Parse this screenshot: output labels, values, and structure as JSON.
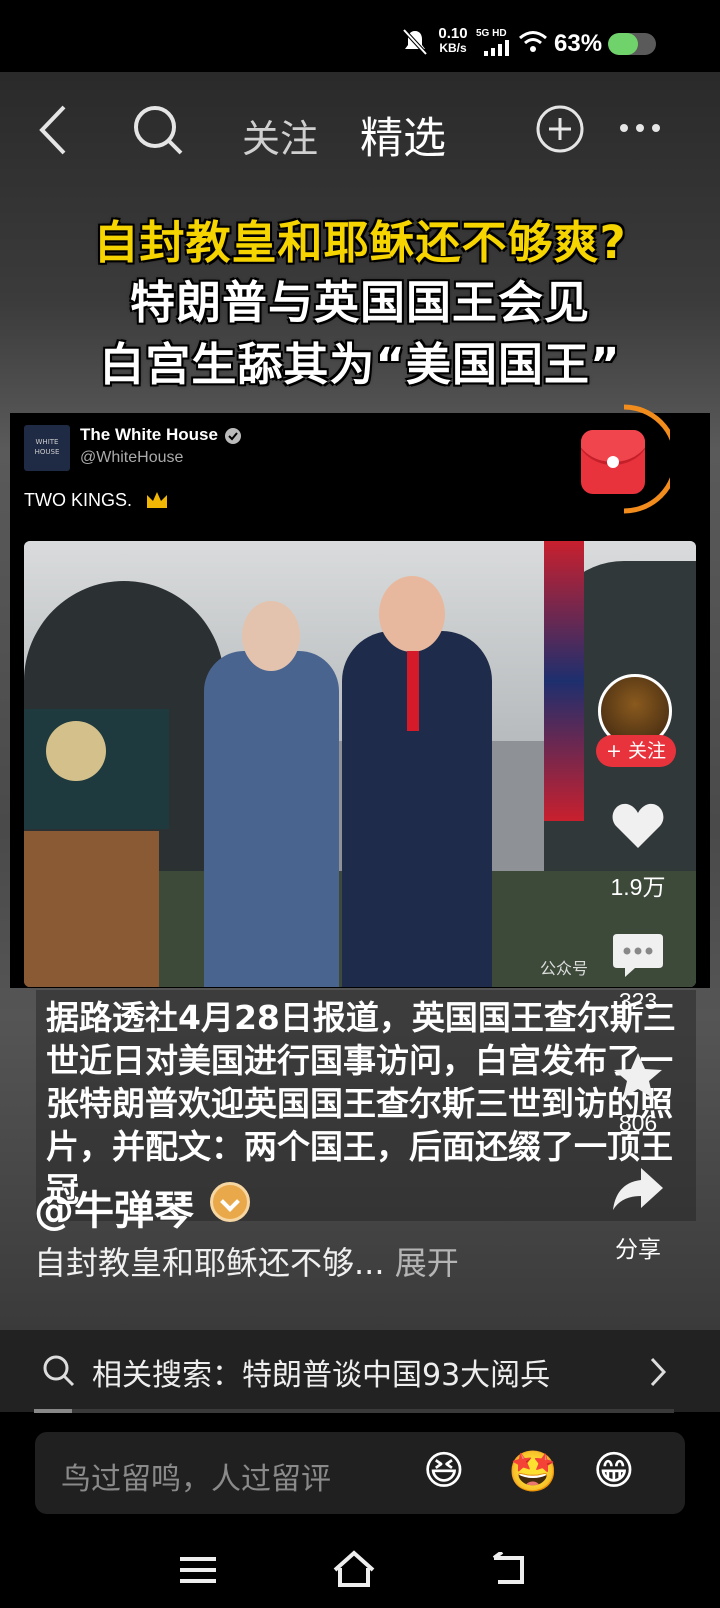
{
  "status_bar": {
    "network_speed": "0.10",
    "network_unit": "KB/s",
    "signal_label": "5G HD",
    "battery": "63%",
    "icons": [
      "mute-icon",
      "signal-icon",
      "wifi-icon",
      "battery-icon"
    ]
  },
  "top_nav": {
    "tab_follow": "关注",
    "tab_featured": "精选",
    "icons": [
      "back-icon",
      "search-icon",
      "add-icon",
      "more-icon"
    ]
  },
  "headline": {
    "line1": "自封教皇和耶稣还不够爽?",
    "line2": "特朗普与英国国王会见",
    "line3": "白宫生舔其为“美国国王”"
  },
  "tweet": {
    "account_name": "The White House",
    "handle": "@WhiteHouse",
    "text": "TWO KINGS.",
    "watermark": "公众号"
  },
  "caption": {
    "text": "据路透社4月28日报道，英国国王查尔斯三世近日对美国进行国事访问，白宫发布了一张特朗普欢迎英国国王查尔斯三世到访的照片，并配文：两个国王，后面还缀了一顶王冠"
  },
  "sidebar": {
    "follow_label": "+ 关注",
    "like_count": "1.9万",
    "comment_count": "323",
    "favorite_count": "806",
    "share_label": "分享"
  },
  "author": {
    "name": "@牛弹琴",
    "desc": "自封教皇和耶稣还不够...",
    "expand": "展开"
  },
  "related": {
    "label": "相关搜索：特朗普谈中国93大阅兵"
  },
  "comment_box": {
    "placeholder": "鸟过留鸣，人过留评",
    "emojis": [
      "😆",
      "🤩",
      "😁"
    ]
  },
  "colors": {
    "accent_red": "#e8333c",
    "headline_yellow": "#f5d400",
    "progress_orange": "#f28c1c"
  }
}
